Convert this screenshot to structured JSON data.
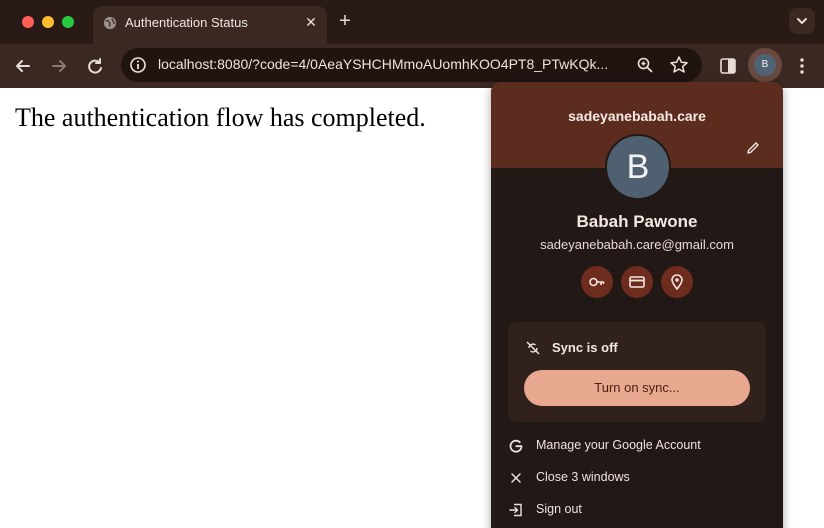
{
  "browser": {
    "tab": {
      "title": "Authentication Status"
    },
    "url": "localhost:8080/?code=4/0AeaYSHCHMmoAUomhKOO4PT8_PTwKQk...",
    "profile_initial": "B"
  },
  "page": {
    "message": "The authentication flow has completed."
  },
  "profile_popup": {
    "domain": "sadeyanebabah.care",
    "avatar_initial": "B",
    "name": "Babah Pawone",
    "email": "sadeyanebabah.care@gmail.com",
    "sync_status": "Sync is off",
    "sync_button": "Turn on sync...",
    "menu": [
      {
        "label": "Manage your Google Account",
        "icon": "google-icon"
      },
      {
        "label": "Close 3 windows",
        "icon": "close-icon"
      },
      {
        "label": "Sign out",
        "icon": "sign-out-icon"
      }
    ]
  },
  "colors": {
    "tab_strip": "#2a1a16",
    "toolbar": "#3b2822",
    "popup_header": "#5c2d1f",
    "popup_body": "#221815",
    "sync_button": "#e8a78f"
  }
}
